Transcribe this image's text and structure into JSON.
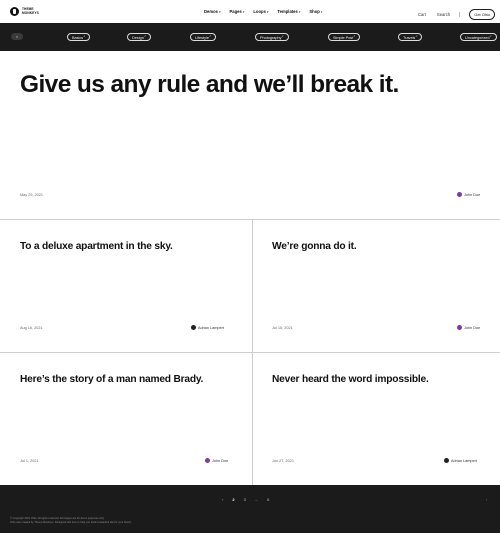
{
  "header": {
    "logo_line1": "THEME",
    "logo_line2": "MONKEYS",
    "nav": [
      "Demos",
      "Pages",
      "Loops",
      "Templates",
      "Shop"
    ],
    "cart": "Cart",
    "search": "Search",
    "cta": "Get Ohio"
  },
  "categories": [
    "Basics",
    "Design",
    "Lifestyle",
    "Photography",
    "Simple Post",
    "Travels",
    "Uncategorized"
  ],
  "hero": {
    "title": "Give us any rule and we’ll break it.",
    "date": "May 29, 2021",
    "author": "John Doe"
  },
  "posts": [
    {
      "title": "To a deluxe apartment in the sky.",
      "date": "Aug 16, 2021",
      "author": "Adrian Lampert"
    },
    {
      "title": "We’re gonna do it.",
      "date": "Jul 15, 2021",
      "author": "John Doe"
    },
    {
      "title": "Here’s the story of a man named Brady.",
      "date": "Jul 1, 2021",
      "author": "John Doe"
    },
    {
      "title": "Never heard the word impossible.",
      "date": "Jun 27, 2021",
      "author": "Adrian Lampert"
    }
  ],
  "pagination": {
    "prev": "‹",
    "pages": [
      "2",
      "3"
    ],
    "ellipsis": "...",
    "last": "6",
    "next": "›"
  },
  "footer": {
    "line1": "© Copyright 2021 Ohio. All rights reserved. All images are for demo purposes only.",
    "line2": "Ohio was created by Theme Monkeys. Designed with love to help you build a beautiful site for your brand."
  },
  "colors": {
    "dark_band": "#1b1b1b",
    "author_avatar_purple": "#7d3c98",
    "divider": "#cfcfcf"
  }
}
